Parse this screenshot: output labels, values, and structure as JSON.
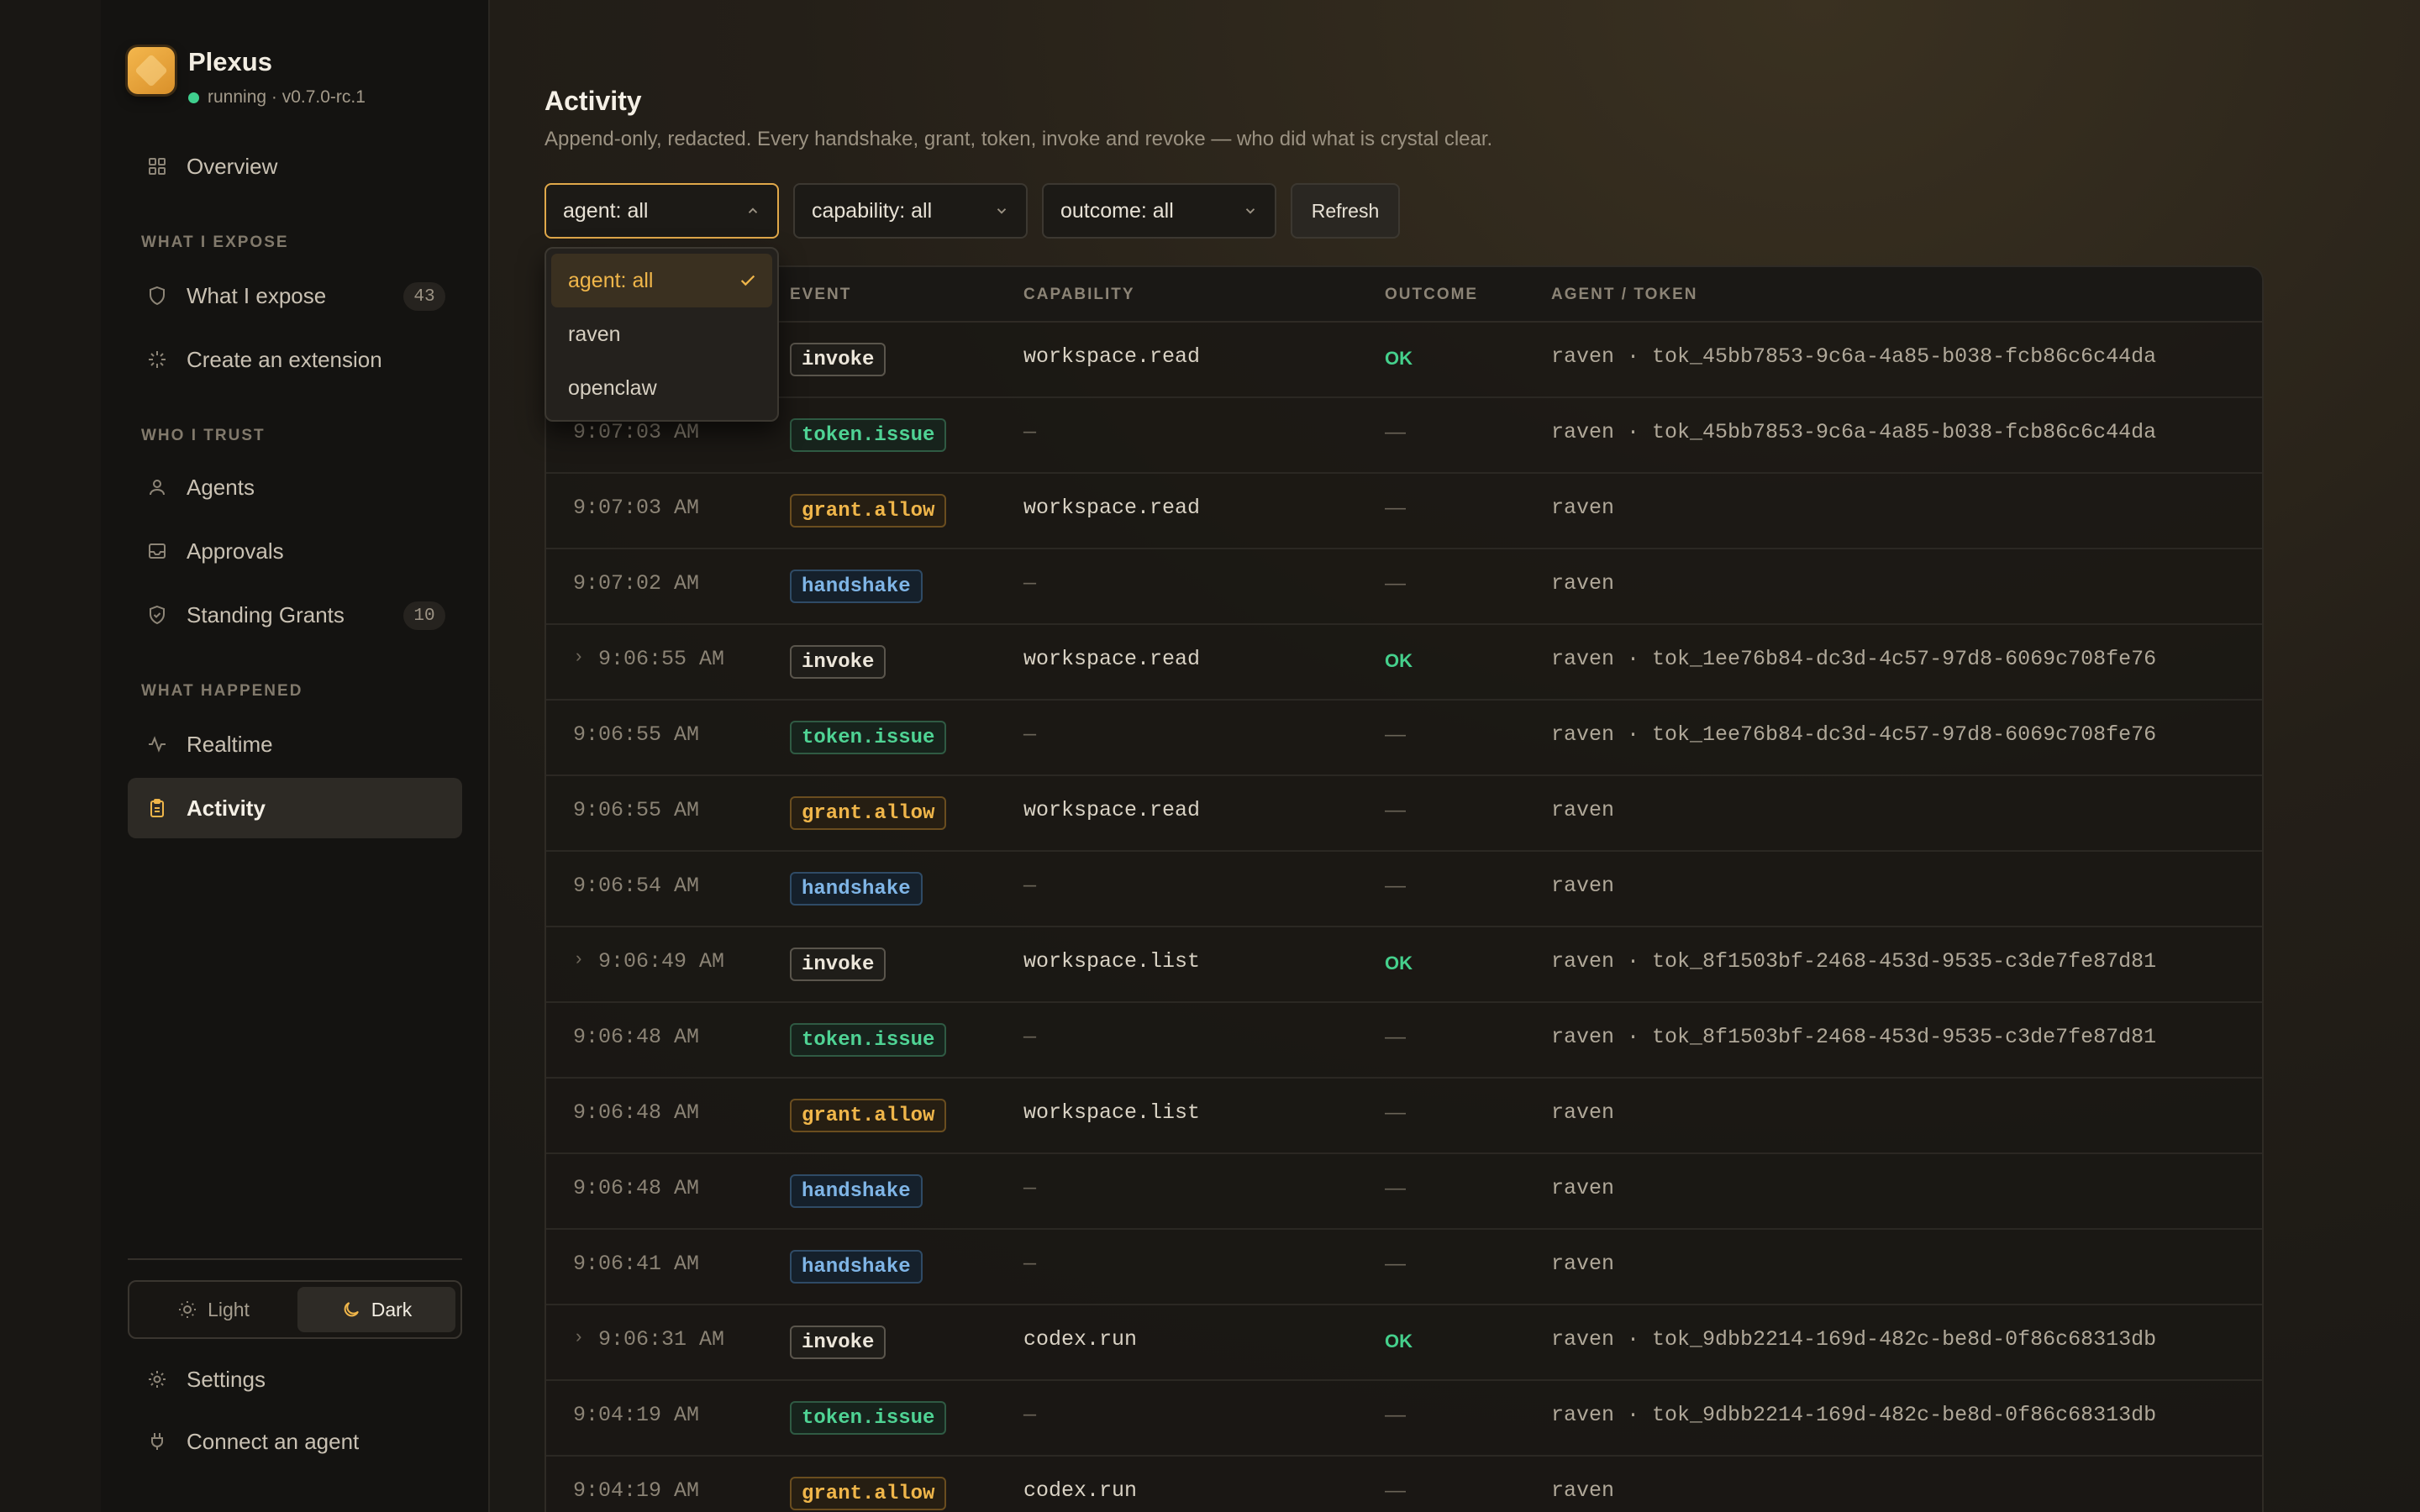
{
  "app": {
    "name": "Plexus",
    "status": "running · v0.7.0-rc.1",
    "accent": "#f0b64a"
  },
  "sidebar": {
    "overview": "Overview",
    "sections": {
      "expose": "WHAT I EXPOSE",
      "trust": "WHO I TRUST",
      "happened": "WHAT HAPPENED"
    },
    "items": {
      "what_i_expose": {
        "label": "What I expose",
        "count": "43"
      },
      "create_extension": {
        "label": "Create an extension"
      },
      "agents": {
        "label": "Agents"
      },
      "approvals": {
        "label": "Approvals"
      },
      "standing_grants": {
        "label": "Standing Grants",
        "count": "10"
      },
      "realtime": {
        "label": "Realtime"
      },
      "activity": {
        "label": "Activity"
      }
    },
    "theme": {
      "light": "Light",
      "dark": "Dark",
      "selected": "Dark"
    },
    "settings": "Settings",
    "connect": "Connect an agent"
  },
  "main": {
    "title": "Activity",
    "subtitle": "Append-only, redacted. Every handshake, grant, token, invoke and revoke — who did what is crystal clear.",
    "filters": {
      "agent": "agent: all",
      "capability": "capability: all",
      "outcome": "outcome: all",
      "refresh": "Refresh"
    },
    "agent_dropdown": {
      "options": [
        "agent: all",
        "raven",
        "openclaw"
      ],
      "selected": "agent: all"
    },
    "table": {
      "headers": {
        "event": "EVENT",
        "capability": "CAPABILITY",
        "outcome": "OUTCOME",
        "agent": "AGENT / TOKEN"
      },
      "rows": [
        {
          "time": "",
          "event": "invoke",
          "capability": "workspace.read",
          "outcome": "OK",
          "agent": "raven · tok_45bb7853-9c6a-4a85-b038-fcb86c6c44da"
        },
        {
          "time": "9:07:03 AM",
          "event": "token.issue",
          "capability": "—",
          "outcome": "—",
          "agent": "raven · tok_45bb7853-9c6a-4a85-b038-fcb86c6c44da"
        },
        {
          "time": "9:07:03 AM",
          "event": "grant.allow",
          "capability": "workspace.read",
          "outcome": "—",
          "agent": "raven"
        },
        {
          "time": "9:07:02 AM",
          "event": "handshake",
          "capability": "—",
          "outcome": "—",
          "agent": "raven"
        },
        {
          "time": "9:06:55 AM",
          "event": "invoke",
          "capability": "workspace.read",
          "outcome": "OK",
          "agent": "raven · tok_1ee76b84-dc3d-4c57-97d8-6069c708fe76",
          "expandable": "›"
        },
        {
          "time": "9:06:55 AM",
          "event": "token.issue",
          "capability": "—",
          "outcome": "—",
          "agent": "raven · tok_1ee76b84-dc3d-4c57-97d8-6069c708fe76"
        },
        {
          "time": "9:06:55 AM",
          "event": "grant.allow",
          "capability": "workspace.read",
          "outcome": "—",
          "agent": "raven"
        },
        {
          "time": "9:06:54 AM",
          "event": "handshake",
          "capability": "—",
          "outcome": "—",
          "agent": "raven"
        },
        {
          "time": "9:06:49 AM",
          "event": "invoke",
          "capability": "workspace.list",
          "outcome": "OK",
          "agent": "raven · tok_8f1503bf-2468-453d-9535-c3de7fe87d81",
          "expandable": "›"
        },
        {
          "time": "9:06:48 AM",
          "event": "token.issue",
          "capability": "—",
          "outcome": "—",
          "agent": "raven · tok_8f1503bf-2468-453d-9535-c3de7fe87d81"
        },
        {
          "time": "9:06:48 AM",
          "event": "grant.allow",
          "capability": "workspace.list",
          "outcome": "—",
          "agent": "raven"
        },
        {
          "time": "9:06:48 AM",
          "event": "handshake",
          "capability": "—",
          "outcome": "—",
          "agent": "raven"
        },
        {
          "time": "9:06:41 AM",
          "event": "handshake",
          "capability": "—",
          "outcome": "—",
          "agent": "raven"
        },
        {
          "time": "9:06:31 AM",
          "event": "invoke",
          "capability": "codex.run",
          "outcome": "OK",
          "agent": "raven · tok_9dbb2214-169d-482c-be8d-0f86c68313db",
          "expandable": "›"
        },
        {
          "time": "9:04:19 AM",
          "event": "token.issue",
          "capability": "—",
          "outcome": "—",
          "agent": "raven · tok_9dbb2214-169d-482c-be8d-0f86c68313db"
        },
        {
          "time": "9:04:19 AM",
          "event": "grant.allow",
          "capability": "codex.run",
          "outcome": "—",
          "agent": "raven"
        }
      ]
    }
  }
}
